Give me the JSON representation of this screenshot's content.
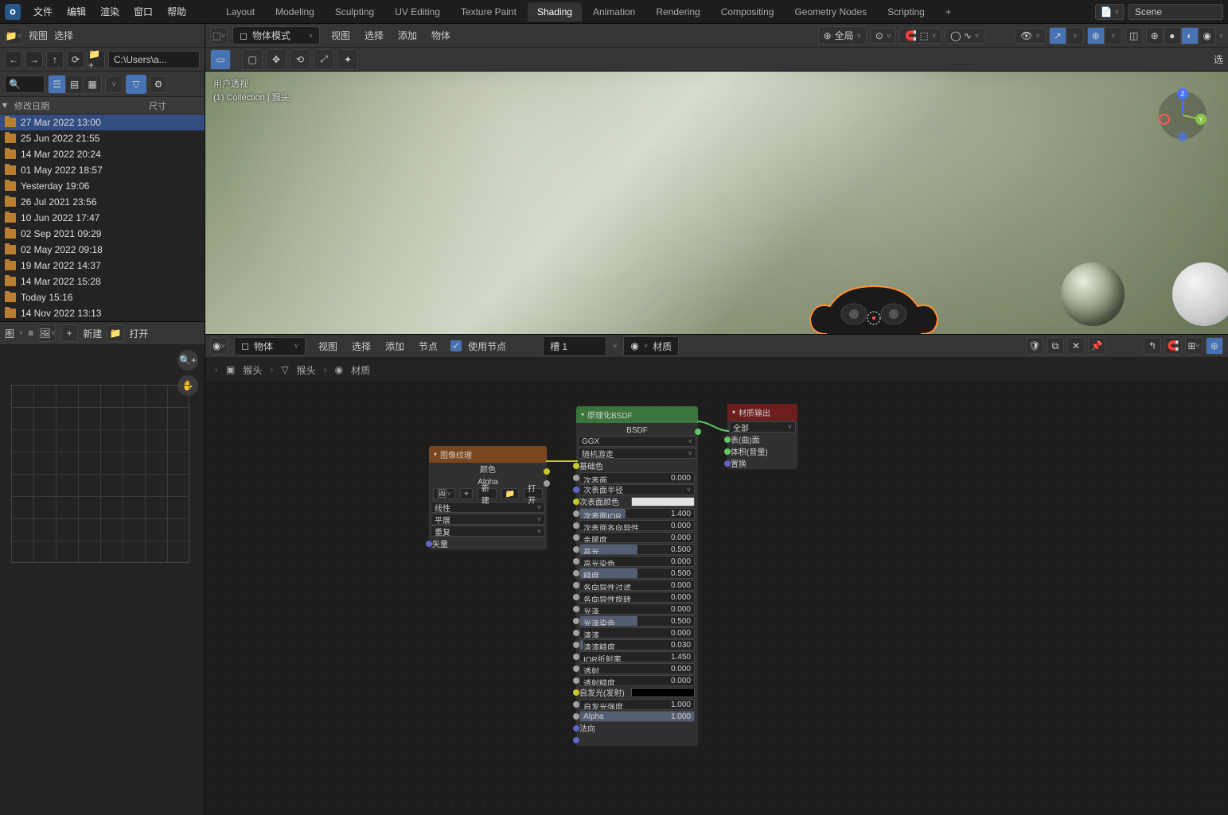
{
  "topmenu": {
    "file": "文件",
    "edit": "编辑",
    "render": "渲染",
    "window": "窗口",
    "help": "帮助"
  },
  "tabs": [
    "Layout",
    "Modeling",
    "Sculpting",
    "UV Editing",
    "Texture Paint",
    "Shading",
    "Animation",
    "Rendering",
    "Compositing",
    "Geometry Nodes",
    "Scripting"
  ],
  "active_tab": "Shading",
  "scene_label": "Scene",
  "filebrowser": {
    "view": "视图",
    "select": "选择",
    "path": "C:\\Users\\a...",
    "col_date": "修改日期",
    "col_size": "尺寸",
    "rows": [
      {
        "date": "27 Mar 2022 13:00",
        "sel": true
      },
      {
        "date": "25 Jun 2022 21:55"
      },
      {
        "date": "14 Mar 2022 20:24"
      },
      {
        "date": "01 May 2022 18:57"
      },
      {
        "date": "Yesterday 19:06"
      },
      {
        "date": "26 Jul 2021 23:56"
      },
      {
        "date": "10 Jun 2022 17:47"
      },
      {
        "date": "02 Sep 2021 09:29"
      },
      {
        "date": "02 May 2022 09:18"
      },
      {
        "date": "19 Mar 2022 14:37"
      },
      {
        "date": "14 Mar 2022 15:28"
      },
      {
        "date": "Today 15:16"
      },
      {
        "date": "14 Nov 2022 13:13"
      }
    ]
  },
  "imgbar": {
    "editor": "图",
    "new": "新建",
    "open": "打开"
  },
  "viewport": {
    "mode": "物体模式",
    "menu": {
      "view": "视图",
      "select": "选择",
      "add": "添加",
      "object": "物体"
    },
    "orient": "全局",
    "info1": "用户透视",
    "info2": "(1) Collection | 猴头",
    "sel": "选"
  },
  "nodebar": {
    "mode": "物体",
    "menu": {
      "view": "视图",
      "select": "选择",
      "add": "添加",
      "node": "节点"
    },
    "use_nodes": "使用节点",
    "slot": "槽 1",
    "material": "材质"
  },
  "crumb": {
    "obj": "猴头",
    "obj2": "猴头",
    "mat": "材质"
  },
  "nodes": {
    "img": {
      "title": "图像纹理",
      "out_color": "颜色",
      "out_alpha": "Alpha",
      "new": "新建",
      "open": "打开",
      "interp": "线性",
      "proj": "平展",
      "ext": "重复",
      "vec": "矢量"
    },
    "bsdf": {
      "title": "原理化BSDF",
      "out": "BSDF",
      "dist": "GGX",
      "sss": "随机游走",
      "base": "基础色",
      "params": [
        {
          "lbl": "次表面",
          "val": "0.000",
          "fill": 0
        },
        {
          "lbl": "次表面半径",
          "val": "",
          "dropdown": true
        },
        {
          "lbl": "次表面颜色",
          "color": "#e3e3e3"
        },
        {
          "lbl": "次表面IOR",
          "val": "1.400",
          "fill": 40
        },
        {
          "lbl": "次表面各向异性",
          "val": "0.000",
          "fill": 0
        },
        {
          "lbl": "金属度",
          "val": "0.000",
          "fill": 0
        },
        {
          "lbl": "高光",
          "val": "0.500",
          "fill": 50
        },
        {
          "lbl": "高光染色",
          "val": "0.000",
          "fill": 0
        },
        {
          "lbl": "糙度",
          "val": "0.500",
          "fill": 50
        },
        {
          "lbl": "各向异性过滤",
          "val": "0.000",
          "fill": 0
        },
        {
          "lbl": "各向异性旋转",
          "val": "0.000",
          "fill": 0
        },
        {
          "lbl": "光泽",
          "val": "0.000",
          "fill": 0
        },
        {
          "lbl": "光泽染色",
          "val": "0.500",
          "fill": 50
        },
        {
          "lbl": "清漆",
          "val": "0.000",
          "fill": 0
        },
        {
          "lbl": "清漆糙度",
          "val": "0.030",
          "fill": 3
        },
        {
          "lbl": "IOR折射率",
          "val": "1.450",
          "fill": 0
        },
        {
          "lbl": "透射",
          "val": "0.000",
          "fill": 0
        },
        {
          "lbl": "透射糙度",
          "val": "0.000",
          "fill": 0
        },
        {
          "lbl": "自发光(发射)",
          "color": "#000000"
        },
        {
          "lbl": "自发光强度",
          "val": "1.000",
          "fill": 0
        },
        {
          "lbl": "Alpha",
          "val": "1.000",
          "fill": 100
        },
        {
          "lbl": "法向",
          "plain": true
        },
        {
          "lbl": "",
          "plain": true
        }
      ]
    },
    "out": {
      "title": "材质输出",
      "target": "全部",
      "surf": "表(曲)面",
      "vol": "体积(音量)",
      "disp": "置换"
    }
  }
}
